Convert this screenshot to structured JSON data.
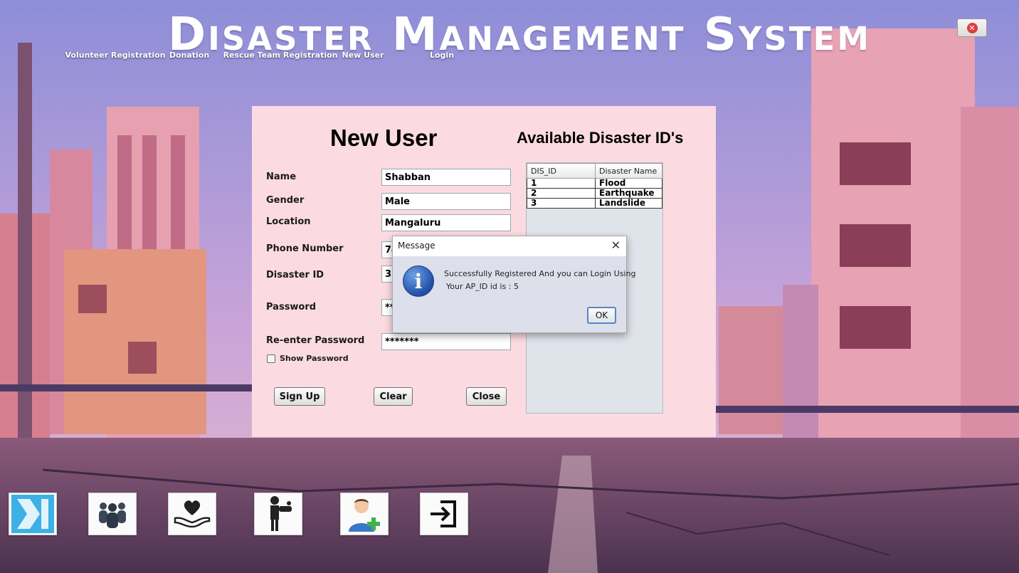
{
  "app": {
    "title": "Disaster Management System"
  },
  "window": {
    "close_label": "✕"
  },
  "form": {
    "title": "New User",
    "fields": {
      "name": {
        "label": "Name",
        "value": "Shabban"
      },
      "gender": {
        "label": "Gender",
        "value": "Male"
      },
      "location": {
        "label": "Location",
        "value": "Mangaluru"
      },
      "phone": {
        "label": "Phone Number",
        "value": "74"
      },
      "disaster_id": {
        "label": "Disaster ID",
        "value": "3"
      },
      "password": {
        "label": "Password",
        "value": "**"
      },
      "reenter_password": {
        "label": "Re-enter Password",
        "value": "*******"
      }
    },
    "show_password": {
      "label": "Show Password",
      "checked": false
    },
    "buttons": {
      "signup": "Sign Up",
      "clear": "Clear",
      "close": "Close"
    }
  },
  "disasters": {
    "title": "Available Disaster ID's",
    "columns": [
      "DIS_ID",
      "Disaster Name"
    ],
    "rows": [
      [
        "1",
        "Flood"
      ],
      [
        "2",
        "Earthquake"
      ],
      [
        "3",
        "Landslide"
      ]
    ]
  },
  "dialog": {
    "title": "Message",
    "close": "✕",
    "icon": "info-icon",
    "icon_glyph": "i",
    "line1": "Successfully Registered And you can Login Using",
    "line2": "Your AP_ID id is : 5",
    "ok": "OK"
  },
  "dock": {
    "items": [
      {
        "id": "next",
        "label": "",
        "icon": "skip-forward-icon"
      },
      {
        "id": "volunteer",
        "label": "Volunteer Registration",
        "icon": "group-icon"
      },
      {
        "id": "donation",
        "label": "Donation",
        "icon": "heart-hand-icon"
      },
      {
        "id": "rescue",
        "label": "Rescue Team Registration",
        "icon": "rescuer-icon"
      },
      {
        "id": "newuser",
        "label": "New User",
        "icon": "add-user-icon"
      },
      {
        "id": "login",
        "label": "Login",
        "icon": "login-icon"
      }
    ]
  },
  "colors": {
    "panel": "#fbdbe1",
    "sky_top": "#8f8fd6",
    "road": "#5a3a55",
    "accent_blue": "#35a6dd"
  }
}
